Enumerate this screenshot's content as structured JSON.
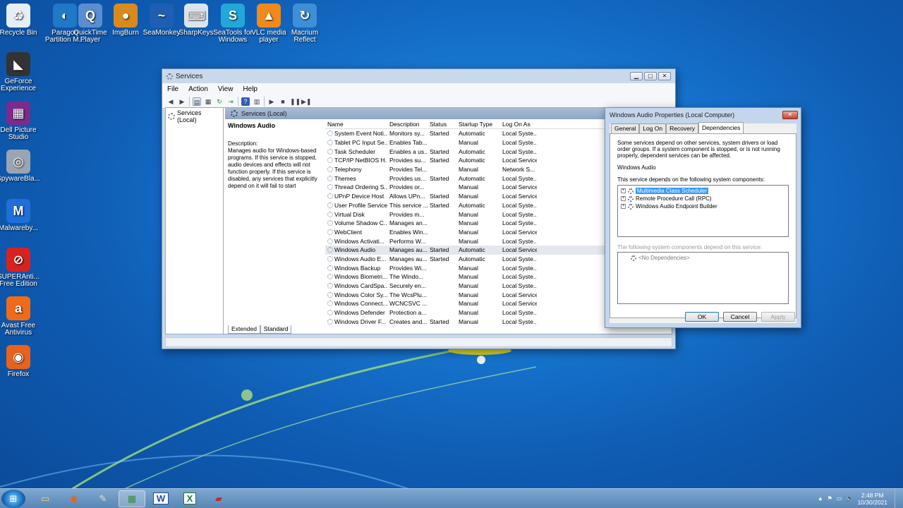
{
  "desktop": {
    "icons": [
      {
        "label": "Recycle Bin",
        "icon": "recycle-bin-icon",
        "color": "#e6eef7",
        "glyph": "♻"
      },
      {
        "label": "Paragon Partition M...",
        "icon": "paragon-icon",
        "color": "#1f78c8",
        "glyph": "◐"
      },
      {
        "label": "QuickTime Player",
        "icon": "quicktime-icon",
        "color": "#5a8ed0",
        "glyph": "Q"
      },
      {
        "label": "ImgBurn",
        "icon": "imgburn-icon",
        "color": "#d98a1e",
        "glyph": "●"
      },
      {
        "label": "SeaMonkey",
        "icon": "seamonkey-icon",
        "color": "#1e5fb3",
        "glyph": "~"
      },
      {
        "label": "SharpKeys",
        "icon": "sharpkeys-icon",
        "color": "#dbe4ec",
        "glyph": "⌨"
      },
      {
        "label": "SeaTools for Windows",
        "icon": "seatools-icon",
        "color": "#23a7d8",
        "glyph": "S"
      },
      {
        "label": "VLC media player",
        "icon": "vlc-icon",
        "color": "#f08a1c",
        "glyph": "▲"
      },
      {
        "label": "Macrium Reflect",
        "icon": "macrium-icon",
        "color": "#3d8fd6",
        "glyph": "↻"
      },
      {
        "label": "GeForce Experience",
        "icon": "geforce-icon",
        "color": "#333333",
        "glyph": "◣"
      },
      {
        "label": "Dell Picture Studio",
        "icon": "dell-picture-icon",
        "color": "#7a2b8c",
        "glyph": "▦"
      },
      {
        "label": "SpywareBla...",
        "icon": "spywareblaster-icon",
        "color": "#9aa5b2",
        "glyph": "◎"
      },
      {
        "label": "Malwareby...",
        "icon": "malwarebytes-icon",
        "color": "#1e6fd9",
        "glyph": "M"
      },
      {
        "label": "SUPERAnti... Free Edition",
        "icon": "superantispyware-icon",
        "color": "#d8221f",
        "glyph": "⊘"
      },
      {
        "label": "Avast Free Antivirus",
        "icon": "avast-icon",
        "color": "#f06a1a",
        "glyph": "a"
      },
      {
        "label": "Firefox",
        "icon": "firefox-icon",
        "color": "#e8621d",
        "glyph": "◉"
      }
    ]
  },
  "services": {
    "title": "Services",
    "menu": [
      "File",
      "Action",
      "View",
      "Help"
    ],
    "tree_item": "Services (Local)",
    "pane_header": "Services (Local)",
    "selected_name": "Windows Audio",
    "description_label": "Description:",
    "description_text": "Manages audio for Windows-based programs.  If this service is stopped, audio devices and effects will not function properly.  If this service is disabled, any services that explicitly depend on it will fail to start",
    "columns": [
      "Name",
      "Description",
      "Status",
      "Startup Type",
      "Log On As"
    ],
    "rows": [
      [
        "System Event Noti...",
        "Monitors sy...",
        "Started",
        "Automatic",
        "Local Syste..."
      ],
      [
        "Tablet PC Input Se...",
        "Enables Tab...",
        "",
        "Manual",
        "Local Syste..."
      ],
      [
        "Task Scheduler",
        "Enables a us...",
        "Started",
        "Automatic",
        "Local Syste..."
      ],
      [
        "TCP/IP NetBIOS H...",
        "Provides su...",
        "Started",
        "Automatic",
        "Local Service"
      ],
      [
        "Telephony",
        "Provides Tel...",
        "",
        "Manual",
        "Network S..."
      ],
      [
        "Themes",
        "Provides us...",
        "Started",
        "Automatic",
        "Local Syste..."
      ],
      [
        "Thread Ordering S...",
        "Provides or...",
        "",
        "Manual",
        "Local Service"
      ],
      [
        "UPnP Device Host",
        "Allows UPn...",
        "Started",
        "Manual",
        "Local Service"
      ],
      [
        "User Profile Service",
        "This service ...",
        "Started",
        "Automatic",
        "Local Syste..."
      ],
      [
        "Virtual Disk",
        "Provides m...",
        "",
        "Manual",
        "Local Syste..."
      ],
      [
        "Volume Shadow C...",
        "Manages an...",
        "",
        "Manual",
        "Local Syste..."
      ],
      [
        "WebClient",
        "Enables Win...",
        "",
        "Manual",
        "Local Service"
      ],
      [
        "Windows Activati...",
        "Performs W...",
        "",
        "Manual",
        "Local Syste..."
      ],
      [
        "Windows Audio",
        "Manages au...",
        "Started",
        "Automatic",
        "Local Service"
      ],
      [
        "Windows Audio E...",
        "Manages au...",
        "Started",
        "Automatic",
        "Local Syste..."
      ],
      [
        "Windows Backup",
        "Provides Wi...",
        "",
        "Manual",
        "Local Syste..."
      ],
      [
        "Windows Biometri...",
        "The Windo...",
        "",
        "Manual",
        "Local Syste..."
      ],
      [
        "Windows CardSpa...",
        "Securely en...",
        "",
        "Manual",
        "Local Syste..."
      ],
      [
        "Windows Color Sy...",
        "The WcsPlu...",
        "",
        "Manual",
        "Local Service"
      ],
      [
        "Windows Connect...",
        "WCNCSVC ...",
        "",
        "Manual",
        "Local Service"
      ],
      [
        "Windows Defender",
        "Protection a...",
        "",
        "Manual",
        "Local Syste..."
      ],
      [
        "Windows Driver F...",
        "Creates and...",
        "Started",
        "Manual",
        "Local Syste..."
      ]
    ],
    "bottom_tabs": [
      "Extended",
      "Standard"
    ]
  },
  "dialog": {
    "title": "Windows Audio Properties (Local Computer)",
    "tabs": [
      "General",
      "Log On",
      "Recovery",
      "Dependencies"
    ],
    "intro": "Some services depend on other services, system drivers or load order groups.  If a system component is stopped, or is not running properly, dependent services can be affected.",
    "service_name": "Windows Audio",
    "depends_on_label": "This service depends on the following system components:",
    "depends_on": [
      "Multimedia Class Scheduler",
      "Remote Procedure Call (RPC)",
      "Windows Audio Endpoint Builder"
    ],
    "dependents_label": "The following system components depend on this service:",
    "dependents": [
      "<No Dependencies>"
    ],
    "buttons": {
      "ok": "OK",
      "cancel": "Cancel",
      "apply": "Apply"
    }
  },
  "taskbar": {
    "clock_time": "2:48 PM",
    "clock_date": "10/30/2021",
    "apps": [
      {
        "icon": "explorer-icon",
        "glyph": "▭",
        "color": "#f3d27a"
      },
      {
        "icon": "firefox-icon",
        "glyph": "◉",
        "color": "#e8621d"
      },
      {
        "icon": "paint-icon",
        "glyph": "✎",
        "color": "#e9e2c8"
      },
      {
        "icon": "control-panel-icon",
        "glyph": "▦",
        "color": "#3b8f3b"
      },
      {
        "icon": "word-icon",
        "glyph": "W",
        "color": "#1f4ea1"
      },
      {
        "icon": "excel-icon",
        "glyph": "X",
        "color": "#1e7a3d"
      },
      {
        "icon": "toolbox-icon",
        "glyph": "▰",
        "color": "#c62828"
      }
    ]
  }
}
